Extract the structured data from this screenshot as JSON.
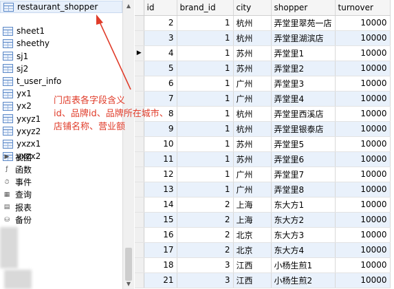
{
  "sidebar": {
    "tables": [
      {
        "label": "restaurant_shopper",
        "selected": true
      },
      {
        "label": "sheet1"
      },
      {
        "label": "sheethy"
      },
      {
        "label": "sj1"
      },
      {
        "label": "sj2"
      },
      {
        "label": "t_user_info"
      },
      {
        "label": "yx1"
      },
      {
        "label": "yx2"
      },
      {
        "label": "yxyz1"
      },
      {
        "label": "yxyz2"
      },
      {
        "label": "yxzx1"
      },
      {
        "label": "yxzx2"
      }
    ],
    "nodes": [
      {
        "label": "视图",
        "icon": "expand-arrow-icon"
      },
      {
        "label": "函数",
        "icon": "function-icon"
      },
      {
        "label": "事件",
        "icon": "event-icon"
      },
      {
        "label": "查询",
        "icon": "query-icon"
      },
      {
        "label": "报表",
        "icon": "report-icon"
      },
      {
        "label": "备份",
        "icon": "backup-icon"
      }
    ]
  },
  "grid": {
    "columns": [
      "id",
      "brand_id",
      "city",
      "shopper",
      "turnover"
    ],
    "rows": [
      {
        "id": "2",
        "brand_id": "1",
        "city": "杭州",
        "shopper": "弄堂里翠苑一店",
        "turnover": "10000"
      },
      {
        "id": "3",
        "brand_id": "1",
        "city": "杭州",
        "shopper": "弄堂里湖滨店",
        "turnover": "10000"
      },
      {
        "id": "4",
        "brand_id": "1",
        "city": "苏州",
        "shopper": "弄堂里1",
        "turnover": "10000",
        "current": true
      },
      {
        "id": "5",
        "brand_id": "1",
        "city": "苏州",
        "shopper": "弄堂里2",
        "turnover": "10000"
      },
      {
        "id": "6",
        "brand_id": "1",
        "city": "广州",
        "shopper": "弄堂里3",
        "turnover": "10000"
      },
      {
        "id": "7",
        "brand_id": "1",
        "city": "广州",
        "shopper": "弄堂里4",
        "turnover": "10000"
      },
      {
        "id": "8",
        "brand_id": "1",
        "city": "杭州",
        "shopper": "弄堂里西溪店",
        "turnover": "10000"
      },
      {
        "id": "9",
        "brand_id": "1",
        "city": "杭州",
        "shopper": "弄堂里银泰店",
        "turnover": "10000"
      },
      {
        "id": "10",
        "brand_id": "1",
        "city": "苏州",
        "shopper": "弄堂里5",
        "turnover": "10000"
      },
      {
        "id": "11",
        "brand_id": "1",
        "city": "苏州",
        "shopper": "弄堂里6",
        "turnover": "10000"
      },
      {
        "id": "12",
        "brand_id": "1",
        "city": "广州",
        "shopper": "弄堂里7",
        "turnover": "10000"
      },
      {
        "id": "13",
        "brand_id": "1",
        "city": "广州",
        "shopper": "弄堂里8",
        "turnover": "10000"
      },
      {
        "id": "14",
        "brand_id": "2",
        "city": "上海",
        "shopper": "东大方1",
        "turnover": "10000"
      },
      {
        "id": "15",
        "brand_id": "2",
        "city": "上海",
        "shopper": "东大方2",
        "turnover": "10000"
      },
      {
        "id": "16",
        "brand_id": "2",
        "city": "北京",
        "shopper": "东大方3",
        "turnover": "10000"
      },
      {
        "id": "17",
        "brand_id": "2",
        "city": "北京",
        "shopper": "东大方4",
        "turnover": "10000"
      },
      {
        "id": "18",
        "brand_id": "3",
        "city": "江西",
        "shopper": "小杨生煎1",
        "turnover": "10000"
      },
      {
        "id": "21",
        "brand_id": "3",
        "city": "江西",
        "shopper": "小杨生煎2",
        "turnover": "10000"
      }
    ]
  },
  "annotation": {
    "lines": [
      "门店表各字段含义",
      "id、品牌id、品牌所在城市、",
      "店铺名称、营业额"
    ],
    "color": "#e03c2a"
  },
  "colors": {
    "row_alt": "#e9f1fb",
    "selected_bg": "#e8f0fb"
  }
}
